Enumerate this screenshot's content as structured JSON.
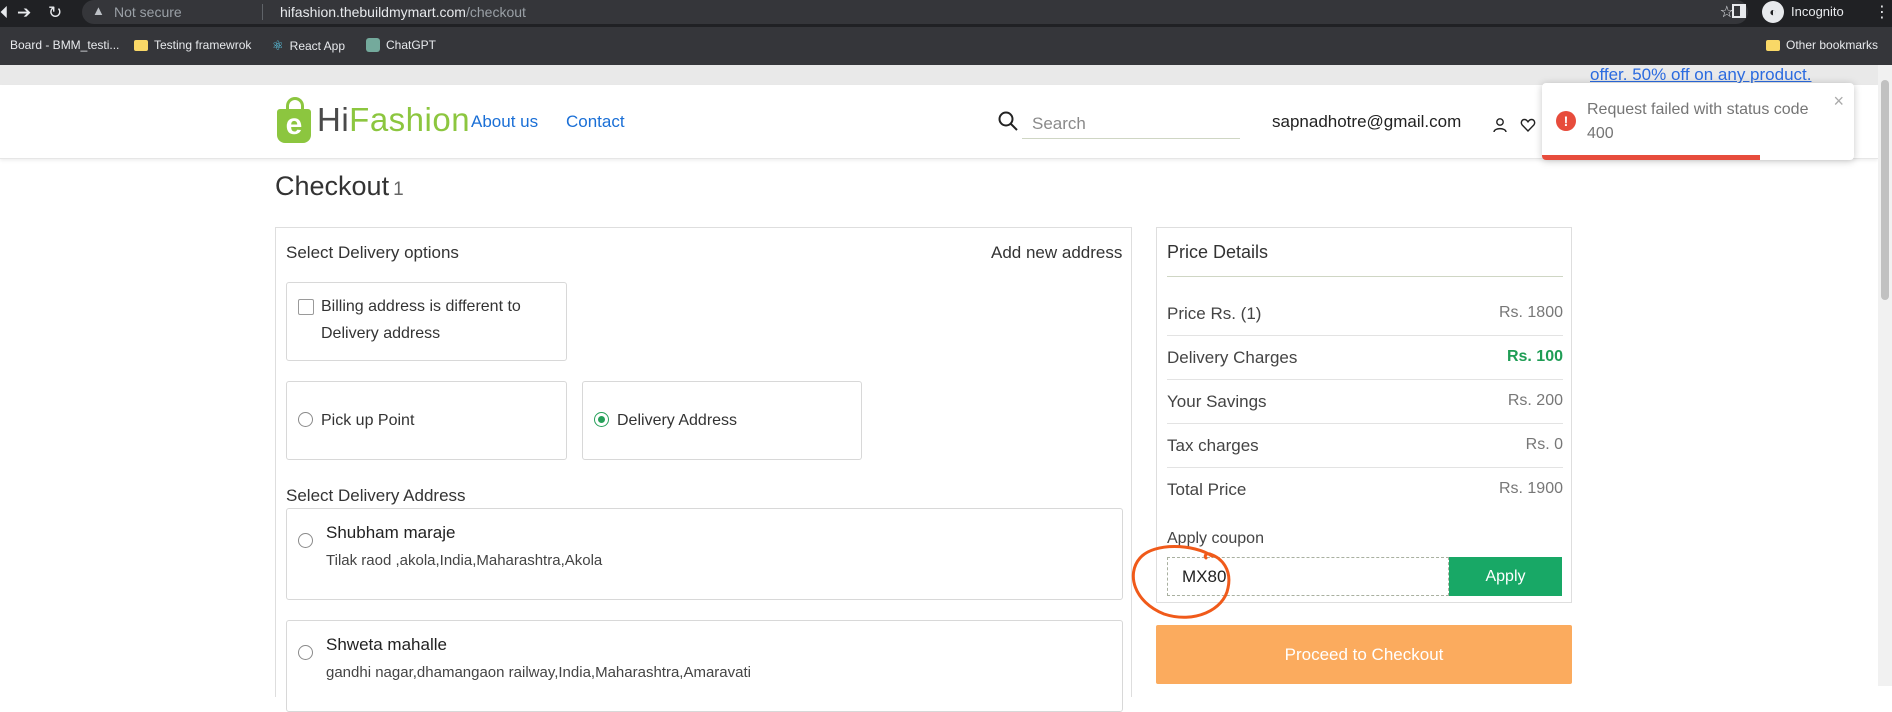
{
  "browser": {
    "security_label": "Not secure",
    "url_host": "hifashion.thebuildmymart.com",
    "url_path": "/checkout",
    "profile_label": "Incognito",
    "bookmarks": [
      "Board - BMM_testi...",
      "Testing framewrok",
      "React App",
      "ChatGPT"
    ],
    "other_bookmarks": "Other bookmarks"
  },
  "banner": {
    "offer_text": "offer. 50% off on any product."
  },
  "header": {
    "logo_text_a": "Hi",
    "logo_text_b": "Fashion",
    "logo_mark": "e",
    "nav": [
      "About us",
      "Contact"
    ],
    "search_placeholder": "Search",
    "user_email": "sapnadhotre@gmail.com"
  },
  "toast": {
    "message": "Request failed with status code 400",
    "close": "×",
    "icon": "!"
  },
  "checkout": {
    "title": "Checkout",
    "count": "1",
    "delivery_options_heading": "Select Delivery options",
    "add_new_address": "Add new address",
    "billing_checkbox_label": "Billing address is different to Delivery address",
    "pickup_label": "Pick up Point",
    "delivery_label": "Delivery Address",
    "select_address_heading": "Select Delivery Address",
    "addresses": [
      {
        "name": "Shubham maraje",
        "line": "Tilak raod ,akola,India,Maharashtra,Akola"
      },
      {
        "name": "Shweta mahalle",
        "line": "gandhi nagar,dhamangaon railway,India,Maharashtra,Amaravati"
      }
    ]
  },
  "price_details": {
    "title": "Price Details",
    "rows": [
      {
        "label": "Price Rs. (1)",
        "value": "Rs. 1800"
      },
      {
        "label": "Delivery Charges",
        "value": "Rs. 100"
      },
      {
        "label": "Your Savings",
        "value": "Rs. 200"
      },
      {
        "label": "Tax charges",
        "value": "Rs. 0"
      },
      {
        "label": "Total Price",
        "value": "Rs. 1900"
      }
    ],
    "coupon_label": "Apply coupon",
    "coupon_value": "MX80",
    "apply_label": "Apply",
    "proceed_label": "Proceed to Checkout"
  },
  "colors": {
    "accent_green": "#18a866",
    "proceed_orange": "#fbab5e",
    "error_red": "#e74c3c",
    "annotation": "#f05a1a"
  }
}
